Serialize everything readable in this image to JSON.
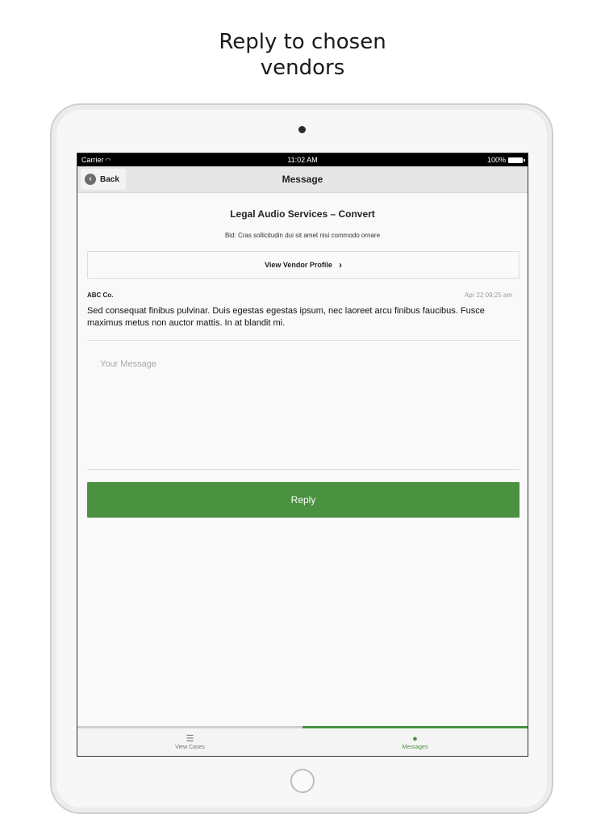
{
  "caption": {
    "line1": "Reply to chosen",
    "line2": "vendors"
  },
  "statusbar": {
    "carrier": "Carrier",
    "time": "11:02 AM",
    "battery": "100%"
  },
  "navbar": {
    "back_label": "Back",
    "title": "Message"
  },
  "vendor": {
    "title": "Legal Audio Services – Convert",
    "bid": "Bid: Cras sollicitudin dui sit amet nisi commodo ornare",
    "profile_label": "View Vendor Profile"
  },
  "message": {
    "sender": "ABC Co.",
    "date": "Apr 22 09:25 am",
    "body": "Sed consequat finibus pulvinar. Duis egestas egestas ipsum, nec laoreet arcu finibus faucibus. Fusce maximus metus non auctor mattis. In at blandit mi."
  },
  "compose": {
    "placeholder": "Your Message",
    "reply_label": "Reply"
  },
  "tabs": [
    {
      "label": "View Cases",
      "icon": "list-icon"
    },
    {
      "label": "Messages",
      "icon": "chat-bubble-icon"
    }
  ],
  "colors": {
    "accent": "#4a9140"
  }
}
